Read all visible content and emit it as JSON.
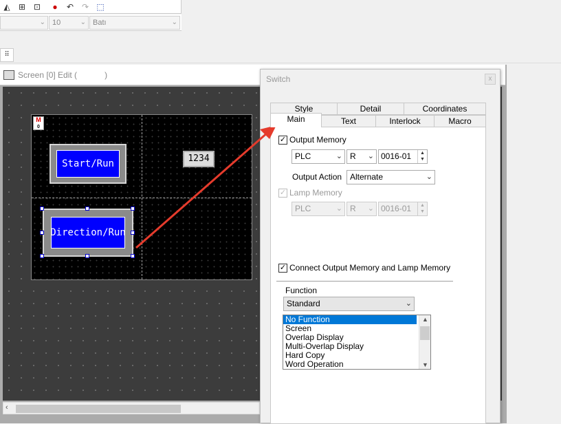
{
  "toolbar": {
    "icons": [
      "style-icon",
      "align-icon",
      "distribute-icon",
      "color-icon",
      "undo-icon",
      "redo-icon",
      "select-icon"
    ],
    "font_size": "10",
    "font_name": "Batı",
    "grid_icon": "grid-icon"
  },
  "editor": {
    "title": "Screen [0] Edit (",
    "title_close": ")",
    "badge": "M",
    "badge_sub": "0",
    "buttons": [
      {
        "label": "Start/Run"
      },
      {
        "label": "Direction/Run"
      }
    ],
    "numeric_display": "1234"
  },
  "dialog": {
    "title": "Switch",
    "close": "x",
    "tabs_back": [
      "Style",
      "Detail",
      "Coordinates"
    ],
    "tabs_front": [
      "Main",
      "Text",
      "Interlock",
      "Macro"
    ],
    "active_tab": "Main",
    "output_memory": {
      "label": "Output Memory",
      "checked": true,
      "device": "PLC",
      "type": "R",
      "address": "0016-01"
    },
    "output_action": {
      "label": "Output Action",
      "value": "Alternate"
    },
    "lamp_memory": {
      "label": "Lamp Memory",
      "checked": true,
      "disabled": true,
      "device": "PLC",
      "type": "R",
      "address": "0016-01"
    },
    "connect_memory": {
      "label": "Connect Output Memory and Lamp Memory",
      "checked": true
    },
    "function": {
      "label": "Function",
      "value": "Standard",
      "list": [
        "No Function",
        "Screen",
        "Overlap Display",
        "Multi-Overlap Display",
        "Hard Copy",
        "Word Operation"
      ],
      "selected": "No Function"
    }
  },
  "colors": {
    "arrow": "#e53b2c",
    "button_fill": "#0000ff",
    "selection": "#0078d7"
  }
}
